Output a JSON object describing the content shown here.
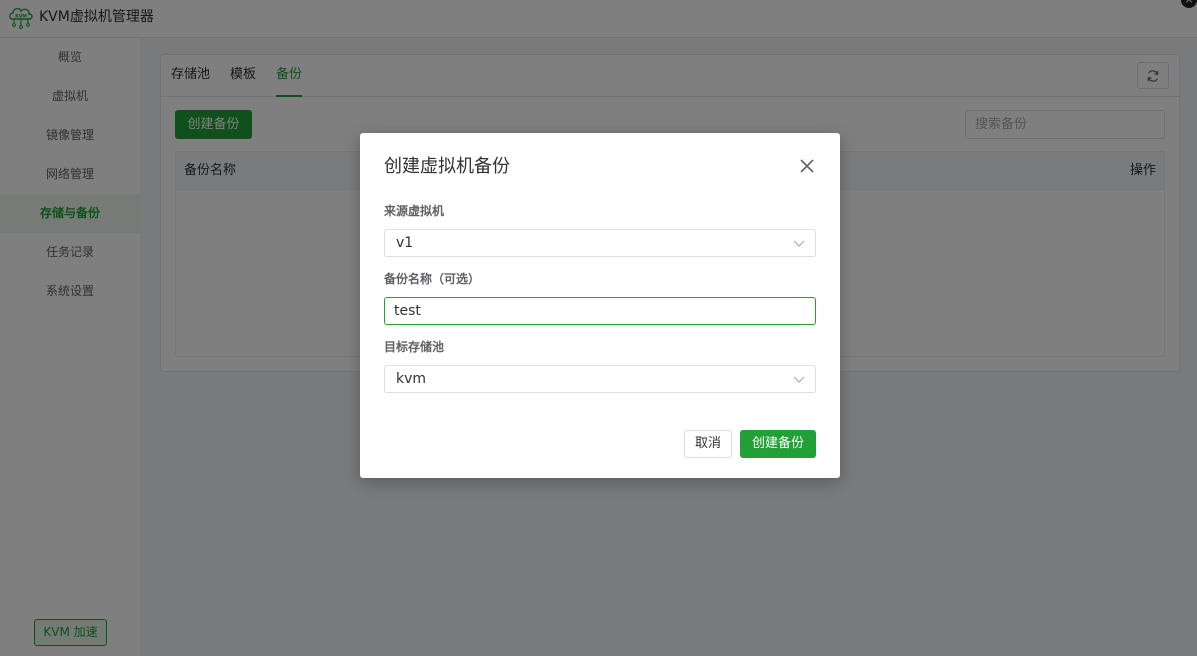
{
  "app": {
    "logo_text": "KVM",
    "title": "KVM虚拟机管理器",
    "window_close_glyph": "×"
  },
  "sidebar": {
    "items": [
      {
        "label": "概览"
      },
      {
        "label": "虚拟机"
      },
      {
        "label": "镜像管理"
      },
      {
        "label": "网络管理"
      },
      {
        "label": "存储与备份",
        "active": true
      },
      {
        "label": "任务记录"
      },
      {
        "label": "系统设置"
      }
    ],
    "accel_button": "KVM 加速"
  },
  "main": {
    "tabs": [
      {
        "label": "存储池"
      },
      {
        "label": "模板"
      },
      {
        "label": "备份",
        "active": true
      }
    ],
    "create_button": "创建备份",
    "search_placeholder": "搜索备份",
    "table": {
      "columns": [
        "备份名称",
        "操作"
      ],
      "rows": []
    }
  },
  "dialog": {
    "title": "创建虚拟机备份",
    "source_vm_label": "来源虚拟机",
    "source_vm_value": "v1",
    "backup_name_label": "备份名称（可选）",
    "backup_name_value": "test",
    "target_pool_label": "目标存储池",
    "target_pool_value": "kvm",
    "cancel_button": "取消",
    "confirm_button": "创建备份"
  },
  "colors": {
    "accent": "#21a038",
    "overlay": "rgba(0,0,0,0.5)"
  }
}
